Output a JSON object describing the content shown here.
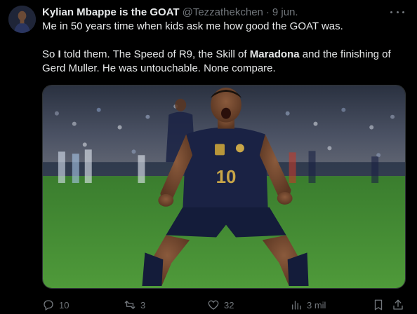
{
  "tweet": {
    "display_name": "Kylian Mbappe is the GOAT",
    "handle": "@Tezzathekchen",
    "separator": "·",
    "time": "9 jun.",
    "line1": "Me in 50 years time when kids ask me how good the GOAT was.",
    "line2_a": "So ",
    "line2_b": "I",
    "line2_c": " told them. The Speed of R9, the Skill of ",
    "line2_d": "Maradona",
    "line2_e": " and the finishing of Gerd Muller. He was untouchable. None compare.",
    "jersey_number": "10"
  },
  "actions": {
    "replies": "10",
    "reposts": "3",
    "likes": "32",
    "views": "3 mil"
  },
  "icons": {
    "reply": "reply-icon",
    "repost": "repost-icon",
    "like": "heart-icon",
    "views": "views-icon",
    "bookmark": "bookmark-icon",
    "share": "share-icon",
    "more": "more-icon"
  },
  "colors": {
    "background": "#000000",
    "text": "#e7e9ea",
    "muted": "#71767b",
    "pitch": "#3f8a34",
    "jersey": "#1a2244"
  }
}
